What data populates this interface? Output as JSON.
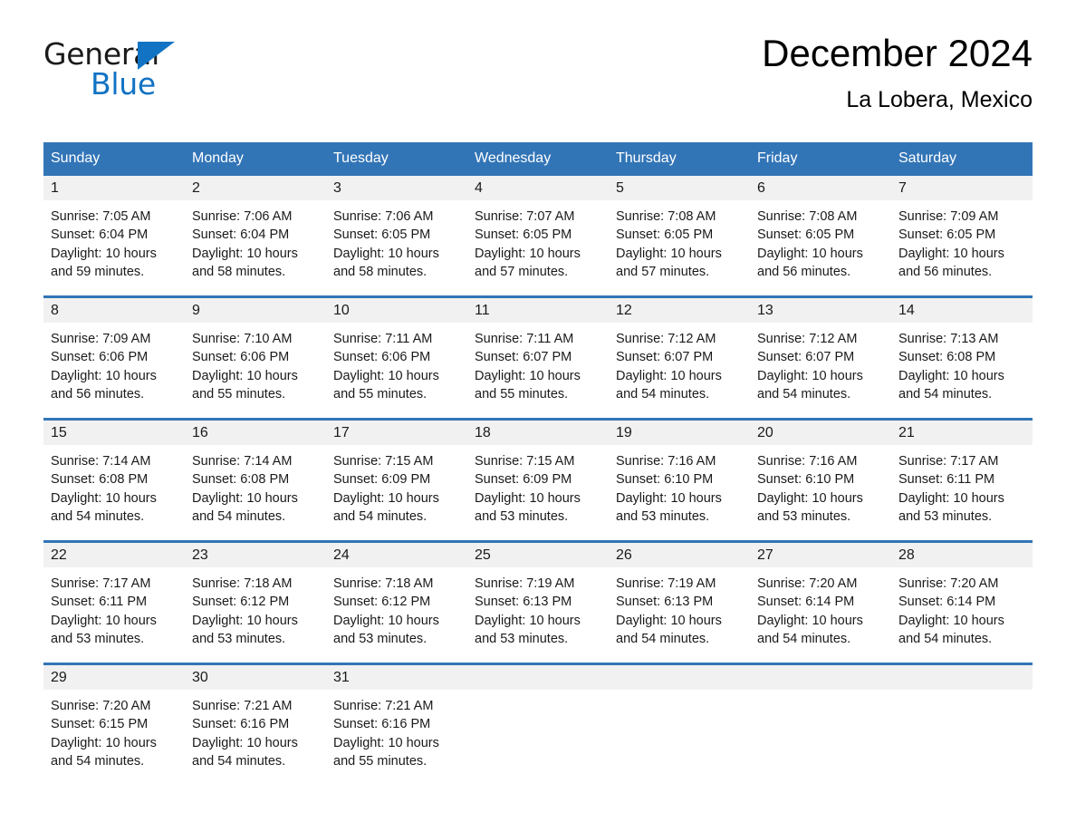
{
  "brand": {
    "name_part1": "General",
    "name_part2": "Blue",
    "logo_icon": "triangle-logo-icon"
  },
  "header": {
    "month_title": "December 2024",
    "location": "La Lobera, Mexico"
  },
  "colors": {
    "header_blue": "#3275b7",
    "brand_blue": "#1273c4",
    "daynum_band": "#f1f1f1"
  },
  "calendar": {
    "weekdays": [
      "Sunday",
      "Monday",
      "Tuesday",
      "Wednesday",
      "Thursday",
      "Friday",
      "Saturday"
    ],
    "weeks": [
      [
        {
          "day": "1",
          "sunrise": "Sunrise: 7:05 AM",
          "sunset": "Sunset: 6:04 PM",
          "daylight": "Daylight: 10 hours and 59 minutes."
        },
        {
          "day": "2",
          "sunrise": "Sunrise: 7:06 AM",
          "sunset": "Sunset: 6:04 PM",
          "daylight": "Daylight: 10 hours and 58 minutes."
        },
        {
          "day": "3",
          "sunrise": "Sunrise: 7:06 AM",
          "sunset": "Sunset: 6:05 PM",
          "daylight": "Daylight: 10 hours and 58 minutes."
        },
        {
          "day": "4",
          "sunrise": "Sunrise: 7:07 AM",
          "sunset": "Sunset: 6:05 PM",
          "daylight": "Daylight: 10 hours and 57 minutes."
        },
        {
          "day": "5",
          "sunrise": "Sunrise: 7:08 AM",
          "sunset": "Sunset: 6:05 PM",
          "daylight": "Daylight: 10 hours and 57 minutes."
        },
        {
          "day": "6",
          "sunrise": "Sunrise: 7:08 AM",
          "sunset": "Sunset: 6:05 PM",
          "daylight": "Daylight: 10 hours and 56 minutes."
        },
        {
          "day": "7",
          "sunrise": "Sunrise: 7:09 AM",
          "sunset": "Sunset: 6:05 PM",
          "daylight": "Daylight: 10 hours and 56 minutes."
        }
      ],
      [
        {
          "day": "8",
          "sunrise": "Sunrise: 7:09 AM",
          "sunset": "Sunset: 6:06 PM",
          "daylight": "Daylight: 10 hours and 56 minutes."
        },
        {
          "day": "9",
          "sunrise": "Sunrise: 7:10 AM",
          "sunset": "Sunset: 6:06 PM",
          "daylight": "Daylight: 10 hours and 55 minutes."
        },
        {
          "day": "10",
          "sunrise": "Sunrise: 7:11 AM",
          "sunset": "Sunset: 6:06 PM",
          "daylight": "Daylight: 10 hours and 55 minutes."
        },
        {
          "day": "11",
          "sunrise": "Sunrise: 7:11 AM",
          "sunset": "Sunset: 6:07 PM",
          "daylight": "Daylight: 10 hours and 55 minutes."
        },
        {
          "day": "12",
          "sunrise": "Sunrise: 7:12 AM",
          "sunset": "Sunset: 6:07 PM",
          "daylight": "Daylight: 10 hours and 54 minutes."
        },
        {
          "day": "13",
          "sunrise": "Sunrise: 7:12 AM",
          "sunset": "Sunset: 6:07 PM",
          "daylight": "Daylight: 10 hours and 54 minutes."
        },
        {
          "day": "14",
          "sunrise": "Sunrise: 7:13 AM",
          "sunset": "Sunset: 6:08 PM",
          "daylight": "Daylight: 10 hours and 54 minutes."
        }
      ],
      [
        {
          "day": "15",
          "sunrise": "Sunrise: 7:14 AM",
          "sunset": "Sunset: 6:08 PM",
          "daylight": "Daylight: 10 hours and 54 minutes."
        },
        {
          "day": "16",
          "sunrise": "Sunrise: 7:14 AM",
          "sunset": "Sunset: 6:08 PM",
          "daylight": "Daylight: 10 hours and 54 minutes."
        },
        {
          "day": "17",
          "sunrise": "Sunrise: 7:15 AM",
          "sunset": "Sunset: 6:09 PM",
          "daylight": "Daylight: 10 hours and 54 minutes."
        },
        {
          "day": "18",
          "sunrise": "Sunrise: 7:15 AM",
          "sunset": "Sunset: 6:09 PM",
          "daylight": "Daylight: 10 hours and 53 minutes."
        },
        {
          "day": "19",
          "sunrise": "Sunrise: 7:16 AM",
          "sunset": "Sunset: 6:10 PM",
          "daylight": "Daylight: 10 hours and 53 minutes."
        },
        {
          "day": "20",
          "sunrise": "Sunrise: 7:16 AM",
          "sunset": "Sunset: 6:10 PM",
          "daylight": "Daylight: 10 hours and 53 minutes."
        },
        {
          "day": "21",
          "sunrise": "Sunrise: 7:17 AM",
          "sunset": "Sunset: 6:11 PM",
          "daylight": "Daylight: 10 hours and 53 minutes."
        }
      ],
      [
        {
          "day": "22",
          "sunrise": "Sunrise: 7:17 AM",
          "sunset": "Sunset: 6:11 PM",
          "daylight": "Daylight: 10 hours and 53 minutes."
        },
        {
          "day": "23",
          "sunrise": "Sunrise: 7:18 AM",
          "sunset": "Sunset: 6:12 PM",
          "daylight": "Daylight: 10 hours and 53 minutes."
        },
        {
          "day": "24",
          "sunrise": "Sunrise: 7:18 AM",
          "sunset": "Sunset: 6:12 PM",
          "daylight": "Daylight: 10 hours and 53 minutes."
        },
        {
          "day": "25",
          "sunrise": "Sunrise: 7:19 AM",
          "sunset": "Sunset: 6:13 PM",
          "daylight": "Daylight: 10 hours and 53 minutes."
        },
        {
          "day": "26",
          "sunrise": "Sunrise: 7:19 AM",
          "sunset": "Sunset: 6:13 PM",
          "daylight": "Daylight: 10 hours and 54 minutes."
        },
        {
          "day": "27",
          "sunrise": "Sunrise: 7:20 AM",
          "sunset": "Sunset: 6:14 PM",
          "daylight": "Daylight: 10 hours and 54 minutes."
        },
        {
          "day": "28",
          "sunrise": "Sunrise: 7:20 AM",
          "sunset": "Sunset: 6:14 PM",
          "daylight": "Daylight: 10 hours and 54 minutes."
        }
      ],
      [
        {
          "day": "29",
          "sunrise": "Sunrise: 7:20 AM",
          "sunset": "Sunset: 6:15 PM",
          "daylight": "Daylight: 10 hours and 54 minutes."
        },
        {
          "day": "30",
          "sunrise": "Sunrise: 7:21 AM",
          "sunset": "Sunset: 6:16 PM",
          "daylight": "Daylight: 10 hours and 54 minutes."
        },
        {
          "day": "31",
          "sunrise": "Sunrise: 7:21 AM",
          "sunset": "Sunset: 6:16 PM",
          "daylight": "Daylight: 10 hours and 55 minutes."
        },
        {
          "day": "",
          "sunrise": "",
          "sunset": "",
          "daylight": ""
        },
        {
          "day": "",
          "sunrise": "",
          "sunset": "",
          "daylight": ""
        },
        {
          "day": "",
          "sunrise": "",
          "sunset": "",
          "daylight": ""
        },
        {
          "day": "",
          "sunrise": "",
          "sunset": "",
          "daylight": ""
        }
      ]
    ]
  }
}
